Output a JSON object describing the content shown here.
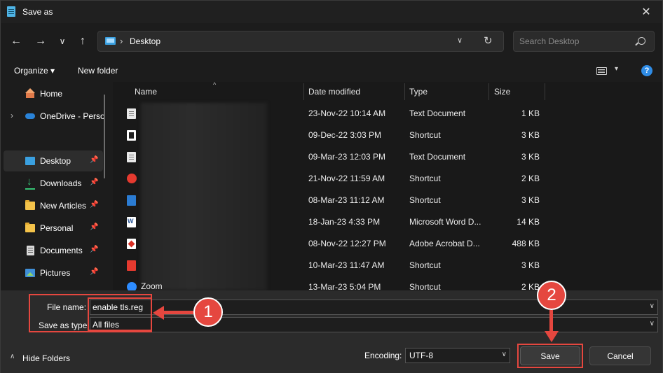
{
  "window": {
    "title": "Save as",
    "close_glyph": "✕"
  },
  "nav": {
    "back": "←",
    "forward": "→",
    "recent": "∨",
    "up": "↑"
  },
  "address": {
    "separator": "›",
    "location": "Desktop",
    "dropdown": "∨",
    "refresh": "↻"
  },
  "search": {
    "placeholder": "Search Desktop"
  },
  "commands": {
    "organize": "Organize ▾",
    "new_folder": "New folder",
    "view_dd": "▾",
    "help": "?"
  },
  "sidebar": {
    "items": [
      {
        "label": "Home",
        "icon": "home-icon"
      },
      {
        "label": "OneDrive - Perso",
        "icon": "cloud-icon",
        "chevron": "›"
      },
      {
        "label": "Desktop",
        "icon": "desktop-icon",
        "pin": "📌"
      },
      {
        "label": "Downloads",
        "icon": "download-icon",
        "pin": "📌"
      },
      {
        "label": "New Articles",
        "icon": "folder-icon",
        "pin": "📌"
      },
      {
        "label": "Personal",
        "icon": "folder-icon",
        "pin": "📌"
      },
      {
        "label": "Documents",
        "icon": "documents-icon",
        "pin": "📌"
      },
      {
        "label": "Pictures",
        "icon": "pictures-icon",
        "pin": "📌"
      }
    ]
  },
  "filelist": {
    "sort_indicator": "^",
    "columns": {
      "name": "Name",
      "date": "Date modified",
      "type": "Type",
      "size": "Size"
    },
    "rows": [
      {
        "icon": "text-file-icon",
        "date": "23-Nov-22 10:14 AM",
        "type": "Text Document",
        "size": "1 KB"
      },
      {
        "icon": "shortcut-icon",
        "date": "09-Dec-22 3:03 PM",
        "type": "Shortcut",
        "size": "3 KB"
      },
      {
        "icon": "text-file-icon",
        "date": "09-Mar-23 12:03 PM",
        "type": "Text Document",
        "size": "3 KB"
      },
      {
        "icon": "app-shortcut-icon",
        "date": "21-Nov-22 11:59 AM",
        "type": "Shortcut",
        "size": "2 KB"
      },
      {
        "icon": "app-shortcut-icon",
        "date": "08-Mar-23 11:12 AM",
        "type": "Shortcut",
        "size": "3 KB"
      },
      {
        "icon": "word-file-icon",
        "date": "18-Jan-23 4:33 PM",
        "type": "Microsoft Word D...",
        "size": "14 KB"
      },
      {
        "icon": "pdf-file-icon",
        "date": "08-Nov-22 12:27 PM",
        "type": "Adobe Acrobat D...",
        "size": "488 KB"
      },
      {
        "icon": "app-shortcut-icon",
        "date": "10-Mar-23 11:47 AM",
        "type": "Shortcut",
        "size": "3 KB"
      },
      {
        "icon": "zoom-icon",
        "name": "Zoom",
        "date": "13-Mar-23 5:04 PM",
        "type": "Shortcut",
        "size": "2 KB"
      }
    ]
  },
  "form": {
    "file_name_label": "File name:",
    "file_name_value": "enable tls.reg",
    "save_type_label": "Save as type:",
    "save_type_value": "All files",
    "dropdown_glyph": "∨",
    "encoding_label": "Encoding:",
    "encoding_value": "UTF-8",
    "save": "Save",
    "cancel": "Cancel",
    "hide_folders": "Hide Folders",
    "hide_chevron": "∧"
  },
  "annotations": {
    "step1": "1",
    "step2": "2",
    "highlight_color": "#e5473f"
  }
}
